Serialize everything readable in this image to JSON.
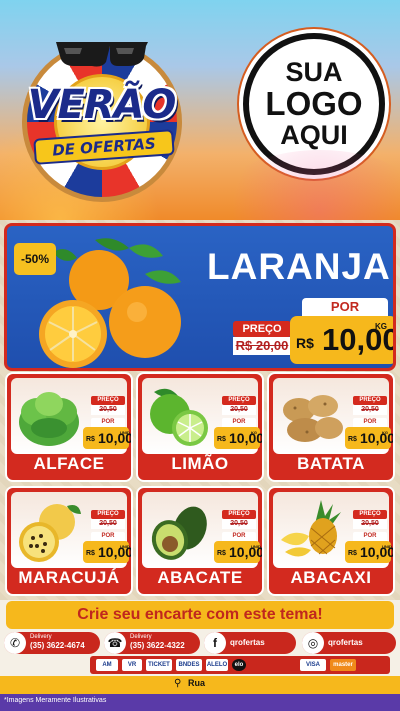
{
  "header": {
    "badge_title": "VERÃO",
    "badge_subtitle": "DE OFERTAS",
    "logo_lines": [
      "SUA",
      "LOGO",
      "AQUI"
    ]
  },
  "hero": {
    "discount": "-50%",
    "product": "LARANJA",
    "preco_label": "PREÇO",
    "old_price": "R$ 20,00",
    "por_label": "POR",
    "currency": "R$",
    "price": "10,00",
    "unit": "KG"
  },
  "products": [
    {
      "name": "ALFACE",
      "preco_label": "PREÇO",
      "old_price": "20,50",
      "por_label": "POR",
      "currency": "R$",
      "price": "10,00",
      "unit": "UNID."
    },
    {
      "name": "LIMÃO",
      "preco_label": "PREÇO",
      "old_price": "20,50",
      "por_label": "POR",
      "currency": "R$",
      "price": "10,00",
      "unit": "KG"
    },
    {
      "name": "BATATA",
      "preco_label": "PREÇO",
      "old_price": "20,50",
      "por_label": "POR",
      "currency": "R$",
      "price": "10,00",
      "unit": "KG"
    },
    {
      "name": "MARACUJÁ",
      "preco_label": "PREÇO",
      "old_price": "20,50",
      "por_label": "POR",
      "currency": "R$",
      "price": "10,00",
      "unit": "UNID."
    },
    {
      "name": "ABACATE",
      "preco_label": "PREÇO",
      "old_price": "20,50",
      "por_label": "POR",
      "currency": "R$",
      "price": "10,00",
      "unit": "UNID."
    },
    {
      "name": "ABACAXI",
      "preco_label": "PREÇO",
      "old_price": "20,50",
      "por_label": "POR",
      "currency": "R$",
      "price": "10,00",
      "unit": "UNID."
    }
  ],
  "footer": {
    "cta": "Crie seu encarte com este tema!",
    "delivery_label": "Delivery",
    "whatsapp": "(35) 3622-4674",
    "phone": "(35) 3622-4322",
    "facebook": "qrofertas",
    "instagram": "qrofertas",
    "payments": [
      "VISA",
      "master",
      "elo",
      "AM",
      "VR",
      "TICKET",
      "BNDES",
      "ALELO"
    ],
    "address": "Rua",
    "disclaimer": "*Imagens Meramente Ilustrativas"
  },
  "colors": {
    "red": "#d32a1f",
    "yellow": "#f6b81c",
    "blue": "#1f4fae",
    "dark_blue": "#1b2b8a"
  }
}
